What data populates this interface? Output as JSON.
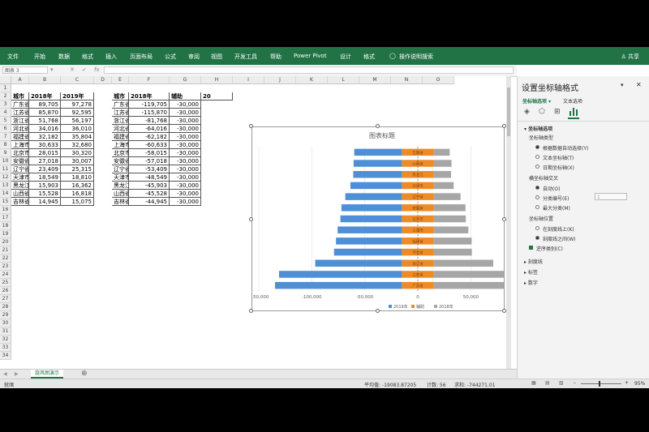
{
  "ribbon": {
    "tabs": [
      "文件",
      "开始",
      "数据",
      "格式",
      "插入",
      "页面布局",
      "公式",
      "审阅",
      "视图",
      "开发工具",
      "帮助",
      "Power Pivot",
      "设计",
      "格式"
    ],
    "tell_me": "操作说明搜索",
    "share": "共享"
  },
  "formula_bar": {
    "name_box": "图表 3",
    "fx": "fx"
  },
  "columns": [
    "A",
    "B",
    "C",
    "D",
    "E",
    "F",
    "G",
    "H",
    "I",
    "J",
    "K",
    "L",
    "M",
    "N",
    "O"
  ],
  "rows": [
    "1",
    "2",
    "3",
    "4",
    "5",
    "6",
    "7",
    "8",
    "9",
    "10",
    "11",
    "12",
    "13",
    "14",
    "15",
    "16",
    "17",
    "18",
    "19",
    "20",
    "21",
    "22",
    "23",
    "24",
    "25",
    "26",
    "27",
    "28",
    "29",
    "30",
    "31",
    "32",
    "33",
    "34"
  ],
  "table1": {
    "headers": [
      "城市",
      "2018年",
      "2019年"
    ],
    "rows": [
      [
        "广东省",
        "89,705",
        "97,278"
      ],
      [
        "江苏省",
        "85,870",
        "92,595"
      ],
      [
        "浙江省",
        "51,768",
        "56,197"
      ],
      [
        "河北省",
        "34,016",
        "36,010"
      ],
      [
        "福建省",
        "32,182",
        "35,804"
      ],
      [
        "上海市",
        "30,633",
        "32,680"
      ],
      [
        "北京市",
        "28,015",
        "30,320"
      ],
      [
        "安徽省",
        "27,018",
        "30,007"
      ],
      [
        "辽宁省",
        "23,409",
        "25,315"
      ],
      [
        "天津市",
        "18,549",
        "18,810"
      ],
      [
        "黑龙江",
        "15,903",
        "16,362"
      ],
      [
        "山西省",
        "15,528",
        "16,818"
      ],
      [
        "吉林省",
        "14,945",
        "15,075"
      ]
    ]
  },
  "table2": {
    "headers": [
      "城市",
      "2018年",
      "辅助",
      "20"
    ],
    "rows": [
      [
        "广东省",
        "-119,705",
        "-30,000"
      ],
      [
        "江苏省",
        "-115,870",
        "-30,000"
      ],
      [
        "浙江省",
        "-81,768",
        "-30,000"
      ],
      [
        "河北省",
        "-64,016",
        "-30,000"
      ],
      [
        "福建省",
        "-62,182",
        "-30,000"
      ],
      [
        "上海市",
        "-60,633",
        "-30,000"
      ],
      [
        "北京市",
        "-58,015",
        "-30,000"
      ],
      [
        "安徽省",
        "-57,018",
        "-30,000"
      ],
      [
        "辽宁省",
        "-53,409",
        "-30,000"
      ],
      [
        "天津市",
        "-48,549",
        "-30,000"
      ],
      [
        "黑龙江",
        "-45,903",
        "-30,000"
      ],
      [
        "山西省",
        "-45,528",
        "-30,000"
      ],
      [
        "吉林省",
        "-44,945",
        "-30,000"
      ]
    ]
  },
  "chart_data": {
    "type": "bar",
    "orientation": "horizontal",
    "stacked": true,
    "title": "图表标题",
    "categories": [
      "吉林省",
      "山西省",
      "黑龙江",
      "天津市",
      "辽宁省",
      "安徽省",
      "北京市",
      "上海市",
      "福建省",
      "河北省",
      "浙江省",
      "江苏省",
      "广东省"
    ],
    "series": [
      {
        "name": "2019年",
        "color": "#4e8fd6",
        "values": [
          -44945,
          -45528,
          -45903,
          -48549,
          -53409,
          -57018,
          -58015,
          -60633,
          -62182,
          -64016,
          -81768,
          -115870,
          -119705
        ]
      },
      {
        "name": "辅助",
        "color": "#f08a24",
        "values": [
          30000,
          30000,
          30000,
          30000,
          30000,
          30000,
          30000,
          30000,
          30000,
          30000,
          30000,
          30000,
          30000
        ]
      },
      {
        "name": "2018年",
        "color": "#a6a6a6",
        "values": [
          15075,
          16818,
          16362,
          18810,
          25315,
          30007,
          30320,
          32680,
          35804,
          36010,
          56197,
          92595,
          97278
        ]
      }
    ],
    "xticks": [
      "-150,000",
      "-100,000",
      "-50,000",
      "0",
      "50,000"
    ],
    "xlim": [
      -150000,
      75000
    ],
    "legend": "bottom",
    "grid": true
  },
  "pane": {
    "title": "设置坐标轴格式",
    "dropdown": "坐标轴选项",
    "text_tab": "文本选项",
    "section": "坐标轴选项",
    "axis_type_label": "坐标轴类型",
    "axis_types": [
      "根据数据自动选择(Y)",
      "文本坐标轴(T)",
      "日期坐标轴(X)"
    ],
    "cross_label": "横坐标轴交叉",
    "cross_opts": [
      "自动(O)",
      "分类编号(E)",
      "最大分类(M)"
    ],
    "cross_value": "1",
    "position_label": "坐标轴位置",
    "position_opts": [
      "在刻度线上(K)",
      "刻度线之间(W)"
    ],
    "reverse": "逆序类别(C)",
    "collapsed": [
      "刻度线",
      "标签",
      "数字"
    ]
  },
  "sheet_tab": "旋风图演示",
  "status": {
    "mode": "就绪",
    "average": "平均值: -19083.87205",
    "count": "计数: 56",
    "sum": "求和: -744271.01",
    "zoom": "95%"
  }
}
